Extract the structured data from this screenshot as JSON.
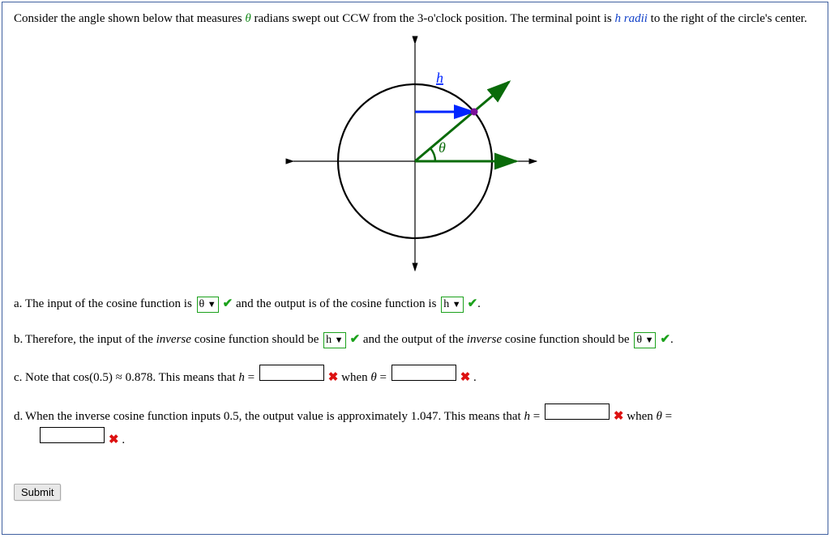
{
  "intro": {
    "pre": "Consider the angle shown below that measures ",
    "theta": "θ",
    "mid": " radians swept out CCW from the 3-o'clock position. The terminal point is ",
    "h_radii": "h radii",
    "post": " to the right of the circle's center."
  },
  "figure": {
    "h_lbl": "h",
    "theta_lbl": "θ"
  },
  "parts": {
    "a": {
      "label": "a. ",
      "t1": "The input of the cosine function is ",
      "sel1": "θ",
      "t2": " and the output is of the cosine function is ",
      "sel2": "h",
      "t3": "."
    },
    "b": {
      "label": "b. ",
      "t1": "Therefore, the input of the ",
      "inverse": "inverse",
      "t2": " cosine function should be ",
      "sel1": "h",
      "t3": " and the output of the ",
      "t4": " cosine function should be ",
      "sel2": "θ",
      "t5": "."
    },
    "c": {
      "label": "c. ",
      "t1": "Note that cos(0.5) ≈ 0.878. This means that ",
      "h": "h",
      "eq": " = ",
      "when": " when ",
      "theta": "θ",
      "dot": " ."
    },
    "d": {
      "label": "d. ",
      "t1": "When the inverse cosine function inputs 0.5, the output value is approximately 1.047. This means that ",
      "h": "h",
      "eq": " = ",
      "when": " when ",
      "theta": "θ",
      "dot": " ."
    }
  },
  "dropdown_caret": "▼",
  "check": "✔",
  "xmark": "✖",
  "submit": "Submit"
}
